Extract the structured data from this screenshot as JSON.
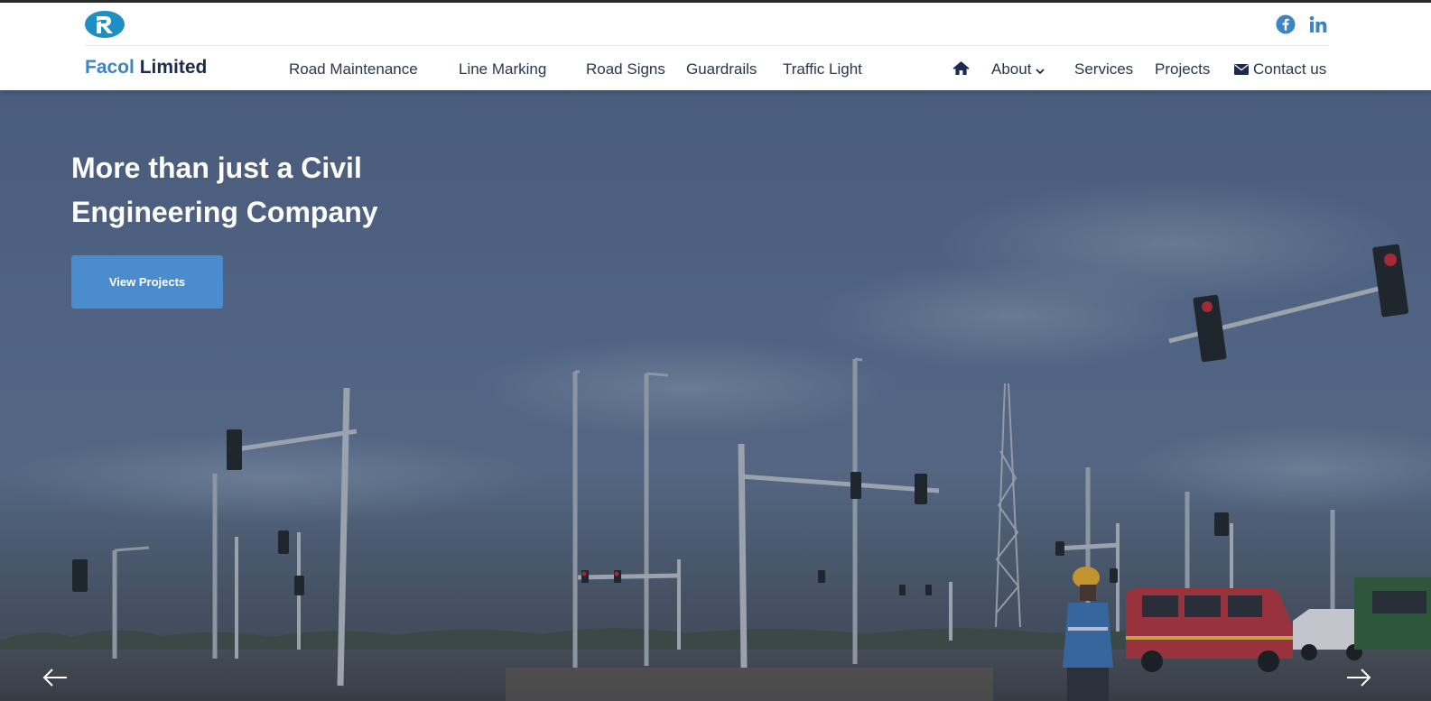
{
  "brand": {
    "part1": "Facol",
    "part2": "Limited"
  },
  "social": {
    "facebook": "facebook-icon",
    "linkedin": "linkedin-icon"
  },
  "nav_left": [
    "Road Maintenance",
    "Line Marking",
    "Road Signs",
    "Guardrails",
    "Traffic Light"
  ],
  "nav_right": {
    "home_icon": "home-icon",
    "about": "About",
    "services": "Services",
    "projects": "Projects",
    "contact": "Contact us",
    "contact_icon": "envelope-icon"
  },
  "hero": {
    "title_line1": "More than just a Civil",
    "title_line2": "Engineering Company",
    "cta": "View Projects",
    "prev_icon": "arrow-left-icon",
    "next_icon": "arrow-right-icon"
  },
  "colors": {
    "brand_blue": "#3d84c6",
    "brand_navy": "#1c2b4d",
    "cta_blue": "#4a8ccd",
    "logo_blue": "#1d8fc3"
  }
}
